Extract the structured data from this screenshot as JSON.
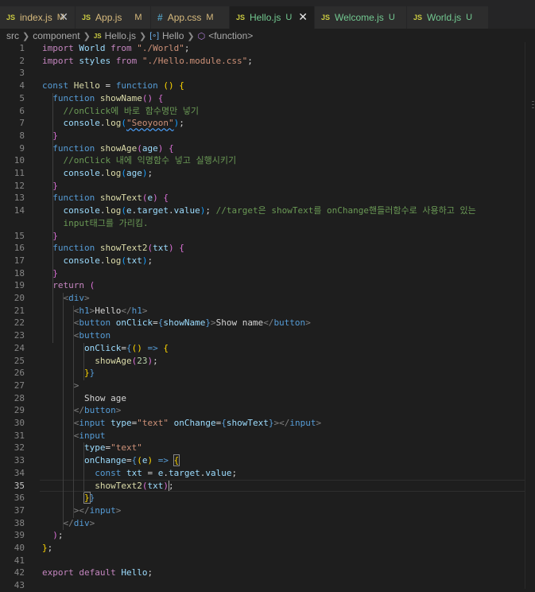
{
  "tabs": [
    {
      "icon": "JS",
      "name": "index.js",
      "status": "M",
      "close": "✕",
      "active": false
    },
    {
      "icon": "JS",
      "name": "App.js",
      "status": "M",
      "active": false
    },
    {
      "icon": "#",
      "name": "App.css",
      "status": "M",
      "active": false
    },
    {
      "icon": "JS",
      "name": "Hello.js",
      "status": "U",
      "close": "✕",
      "active": true
    },
    {
      "icon": "JS",
      "name": "Welcome.js",
      "status": "U",
      "active": false
    },
    {
      "icon": "JS",
      "name": "World.js",
      "status": "U",
      "active": false
    }
  ],
  "breadcrumb": {
    "src": "src",
    "folder": "component",
    "file_icon": "JS",
    "file": "Hello.js",
    "var_icon": "[∘]",
    "var": "Hello",
    "fn_icon": "⬡",
    "fn": "<function>"
  },
  "editor": {
    "current_line": 35,
    "lines": [
      {
        "n": "1"
      },
      {
        "n": "2"
      },
      {
        "n": "3"
      },
      {
        "n": "4"
      },
      {
        "n": "5"
      },
      {
        "n": "6"
      },
      {
        "n": "7"
      },
      {
        "n": "8"
      },
      {
        "n": "9"
      },
      {
        "n": "10"
      },
      {
        "n": "11"
      },
      {
        "n": "12"
      },
      {
        "n": "13"
      },
      {
        "n": "14"
      },
      {
        "n": ""
      },
      {
        "n": "15"
      },
      {
        "n": "16"
      },
      {
        "n": "17"
      },
      {
        "n": "18"
      },
      {
        "n": "19"
      },
      {
        "n": "20"
      },
      {
        "n": "21"
      },
      {
        "n": "22"
      },
      {
        "n": "23"
      },
      {
        "n": "24"
      },
      {
        "n": "25"
      },
      {
        "n": "26"
      },
      {
        "n": "27"
      },
      {
        "n": "28"
      },
      {
        "n": "29"
      },
      {
        "n": "30"
      },
      {
        "n": "31"
      },
      {
        "n": "32"
      },
      {
        "n": "33"
      },
      {
        "n": "34"
      },
      {
        "n": "35"
      },
      {
        "n": "36"
      },
      {
        "n": "37"
      },
      {
        "n": "38"
      },
      {
        "n": "39"
      },
      {
        "n": "40"
      },
      {
        "n": "41"
      },
      {
        "n": "42"
      },
      {
        "n": "43"
      }
    ],
    "code": [
      [
        [
          "k",
          "import "
        ],
        [
          "v",
          "World "
        ],
        [
          "k",
          "from "
        ],
        [
          "s",
          "\"./World\""
        ],
        [
          "p",
          ";"
        ]
      ],
      [
        [
          "k",
          "import "
        ],
        [
          "v",
          "styles "
        ],
        [
          "k",
          "from "
        ],
        [
          "s",
          "\"./Hello.module.css\""
        ],
        [
          "p",
          ";"
        ]
      ],
      [],
      [
        [
          "b",
          "const "
        ],
        [
          "f",
          "Hello "
        ],
        [
          "p",
          "= "
        ],
        [
          "b",
          "function "
        ],
        [
          "y",
          "()"
        ],
        [
          "p",
          " "
        ],
        [
          "y",
          "{"
        ]
      ],
      [
        [
          "p",
          "  "
        ],
        [
          "b",
          "function "
        ],
        [
          "f",
          "showName"
        ],
        [
          "pk",
          "()"
        ],
        [
          "p",
          " "
        ],
        [
          "pk",
          "{"
        ]
      ],
      [
        [
          "p",
          "    "
        ],
        [
          "c",
          "//onClick에 바로 함수명만 넣기"
        ]
      ],
      [
        [
          "p",
          "    "
        ],
        [
          "v",
          "console"
        ],
        [
          "p",
          "."
        ],
        [
          "f",
          "log"
        ],
        [
          "bl",
          "("
        ],
        [
          "s sq",
          "\"Seoyoon\""
        ],
        [
          "bl",
          ")"
        ],
        [
          "p",
          ";"
        ]
      ],
      [
        [
          "p",
          "  "
        ],
        [
          "pk",
          "}"
        ]
      ],
      [
        [
          "p",
          "  "
        ],
        [
          "b",
          "function "
        ],
        [
          "f",
          "showAge"
        ],
        [
          "pk",
          "("
        ],
        [
          "v",
          "age"
        ],
        [
          "pk",
          ")"
        ],
        [
          "p",
          " "
        ],
        [
          "pk",
          "{"
        ]
      ],
      [
        [
          "p",
          "    "
        ],
        [
          "c",
          "//onClick 내에 익명함수 넣고 실행시키기"
        ]
      ],
      [
        [
          "p",
          "    "
        ],
        [
          "v",
          "console"
        ],
        [
          "p",
          "."
        ],
        [
          "f",
          "log"
        ],
        [
          "bl",
          "("
        ],
        [
          "v",
          "age"
        ],
        [
          "bl",
          ")"
        ],
        [
          "p",
          ";"
        ]
      ],
      [
        [
          "p",
          "  "
        ],
        [
          "pk",
          "}"
        ]
      ],
      [
        [
          "p",
          "  "
        ],
        [
          "b",
          "function "
        ],
        [
          "f",
          "showText"
        ],
        [
          "pk",
          "("
        ],
        [
          "v",
          "e"
        ],
        [
          "pk",
          ")"
        ],
        [
          "p",
          " "
        ],
        [
          "pk",
          "{"
        ]
      ],
      [
        [
          "p",
          "    "
        ],
        [
          "v",
          "console"
        ],
        [
          "p",
          "."
        ],
        [
          "f",
          "log"
        ],
        [
          "bl",
          "("
        ],
        [
          "v",
          "e"
        ],
        [
          "p",
          "."
        ],
        [
          "v",
          "target"
        ],
        [
          "p",
          "."
        ],
        [
          "v",
          "value"
        ],
        [
          "bl",
          ")"
        ],
        [
          "p",
          "; "
        ],
        [
          "c",
          "//target은 showText를 onChange핸들러함수로 사용하고 있는"
        ]
      ],
      [
        [
          "p",
          "    "
        ],
        [
          "c",
          "input태그를 가리킴."
        ]
      ],
      [
        [
          "p",
          "  "
        ],
        [
          "pk",
          "}"
        ]
      ],
      [
        [
          "p",
          "  "
        ],
        [
          "b",
          "function "
        ],
        [
          "f",
          "showText2"
        ],
        [
          "pk",
          "("
        ],
        [
          "v",
          "txt"
        ],
        [
          "pk",
          ")"
        ],
        [
          "p",
          " "
        ],
        [
          "pk",
          "{"
        ]
      ],
      [
        [
          "p",
          "    "
        ],
        [
          "v",
          "console"
        ],
        [
          "p",
          "."
        ],
        [
          "f",
          "log"
        ],
        [
          "bl",
          "("
        ],
        [
          "v",
          "txt"
        ],
        [
          "bl",
          ")"
        ],
        [
          "p",
          ";"
        ]
      ],
      [
        [
          "p",
          "  "
        ],
        [
          "pk",
          "}"
        ]
      ],
      [
        [
          "p",
          "  "
        ],
        [
          "k",
          "return "
        ],
        [
          "pk",
          "("
        ]
      ],
      [
        [
          "p",
          "    "
        ],
        [
          "g",
          "<"
        ],
        [
          "b",
          "div"
        ],
        [
          "g",
          ">"
        ]
      ],
      [
        [
          "p",
          "      "
        ],
        [
          "g",
          "<"
        ],
        [
          "b",
          "h1"
        ],
        [
          "g",
          ">"
        ],
        [
          "p",
          "Hello"
        ],
        [
          "g",
          "</"
        ],
        [
          "b",
          "h1"
        ],
        [
          "g",
          ">"
        ]
      ],
      [
        [
          "p",
          "      "
        ],
        [
          "g",
          "<"
        ],
        [
          "b",
          "button "
        ],
        [
          "v",
          "onClick"
        ],
        [
          "p",
          "="
        ],
        [
          "b",
          "{"
        ],
        [
          "v",
          "showName"
        ],
        [
          "b",
          "}"
        ],
        [
          "g",
          ">"
        ],
        [
          "p",
          "Show name"
        ],
        [
          "g",
          "</"
        ],
        [
          "b",
          "button"
        ],
        [
          "g",
          ">"
        ]
      ],
      [
        [
          "p",
          "      "
        ],
        [
          "g",
          "<"
        ],
        [
          "b",
          "button"
        ]
      ],
      [
        [
          "p",
          "        "
        ],
        [
          "v",
          "onClick"
        ],
        [
          "p",
          "="
        ],
        [
          "b",
          "{"
        ],
        [
          "y",
          "()"
        ],
        [
          "p",
          " "
        ],
        [
          "b",
          "=> "
        ],
        [
          "y",
          "{"
        ]
      ],
      [
        [
          "p",
          "          "
        ],
        [
          "f",
          "showAge"
        ],
        [
          "pk",
          "("
        ],
        [
          "n",
          "23"
        ],
        [
          "pk",
          ")"
        ],
        [
          "p",
          ";"
        ]
      ],
      [
        [
          "p",
          "        "
        ],
        [
          "y",
          "}"
        ],
        [
          "b",
          "}"
        ]
      ],
      [
        [
          "p",
          "      "
        ],
        [
          "g",
          ">"
        ]
      ],
      [
        [
          "p",
          "        "
        ],
        [
          "p",
          "Show age"
        ]
      ],
      [
        [
          "p",
          "      "
        ],
        [
          "g",
          "</"
        ],
        [
          "b",
          "button"
        ],
        [
          "g",
          ">"
        ]
      ],
      [
        [
          "p",
          "      "
        ],
        [
          "g",
          "<"
        ],
        [
          "b",
          "input "
        ],
        [
          "v",
          "type"
        ],
        [
          "p",
          "="
        ],
        [
          "s",
          "\"text\" "
        ],
        [
          "v",
          "onChange"
        ],
        [
          "p",
          "="
        ],
        [
          "b",
          "{"
        ],
        [
          "v",
          "showText"
        ],
        [
          "b",
          "}"
        ],
        [
          "g",
          "></"
        ],
        [
          "b",
          "input"
        ],
        [
          "g",
          ">"
        ]
      ],
      [
        [
          "p",
          "      "
        ],
        [
          "g",
          "<"
        ],
        [
          "b",
          "input"
        ]
      ],
      [
        [
          "p",
          "        "
        ],
        [
          "v",
          "type"
        ],
        [
          "p",
          "="
        ],
        [
          "s",
          "\"text\""
        ]
      ],
      [
        [
          "p",
          "        "
        ],
        [
          "v",
          "onChange"
        ],
        [
          "p",
          "="
        ],
        [
          "b",
          "{"
        ],
        [
          "y",
          "("
        ],
        [
          "v",
          "e"
        ],
        [
          "y",
          ")"
        ],
        [
          "p",
          " "
        ],
        [
          "b",
          "=> "
        ],
        [
          "y bm",
          "{"
        ]
      ],
      [
        [
          "p",
          "          "
        ],
        [
          "b",
          "const "
        ],
        [
          "v",
          "txt "
        ],
        [
          "p",
          "= "
        ],
        [
          "v",
          "e"
        ],
        [
          "p",
          "."
        ],
        [
          "v",
          "target"
        ],
        [
          "p",
          "."
        ],
        [
          "v",
          "value"
        ],
        [
          "p",
          ";"
        ]
      ],
      [
        [
          "p",
          "          "
        ],
        [
          "f",
          "showText2"
        ],
        [
          "pk",
          "("
        ],
        [
          "v",
          "txt"
        ],
        [
          "pk",
          ")"
        ],
        [
          "p",
          ";"
        ]
      ],
      [
        [
          "p",
          "        "
        ],
        [
          "y bm",
          "}"
        ],
        [
          "b",
          "}"
        ]
      ],
      [
        [
          "p",
          "      "
        ],
        [
          "g",
          "></"
        ],
        [
          "b",
          "input"
        ],
        [
          "g",
          ">"
        ]
      ],
      [
        [
          "p",
          "    "
        ],
        [
          "g",
          "</"
        ],
        [
          "b",
          "div"
        ],
        [
          "g",
          ">"
        ]
      ],
      [
        [
          "p",
          "  "
        ],
        [
          "pk",
          ")"
        ],
        [
          "p",
          ";"
        ]
      ],
      [
        [
          "y",
          "}"
        ],
        [
          "p",
          ";"
        ]
      ],
      [],
      [
        [
          "k",
          "export default "
        ],
        [
          "v",
          "Hello"
        ],
        [
          "p",
          ";"
        ]
      ],
      []
    ]
  }
}
